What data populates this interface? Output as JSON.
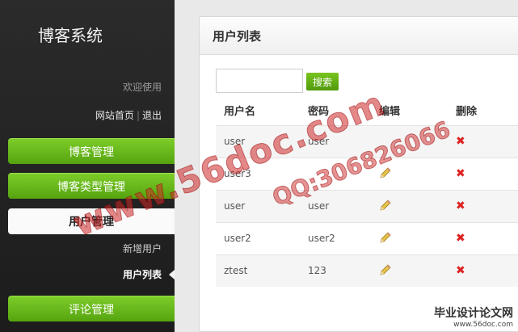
{
  "sidebar": {
    "brand": "博客系统",
    "welcome": "欢迎使用",
    "link_home": "网站首页",
    "link_sep": "|",
    "link_logout": "退出",
    "nav": {
      "blog_manage": "博客管理",
      "blog_type_manage": "博客类型管理",
      "user_manage": "用户管理",
      "sub_add_user": "新增用户",
      "sub_user_list": "用户列表",
      "comment_manage": "评论管理"
    }
  },
  "panel": {
    "title": "用户列表",
    "search_value": "",
    "search_placeholder": "",
    "search_button": "搜索"
  },
  "table": {
    "headers": [
      "用户名",
      "密码",
      "编辑",
      "删除"
    ],
    "rows": [
      {
        "username": "user",
        "password": "user",
        "editable": false
      },
      {
        "username": "user3",
        "password": "",
        "editable": true
      },
      {
        "username": "user",
        "password": "user",
        "editable": true
      },
      {
        "username": "user2",
        "password": "user2",
        "editable": true
      },
      {
        "username": "ztest",
        "password": "123",
        "editable": true
      }
    ],
    "delete_glyph": "✖"
  },
  "watermark": {
    "site": "www.56doc.com",
    "qq": "QQ:306826066"
  },
  "footer_logo": {
    "title": "毕业设计论文网",
    "url": "www.56doc.com"
  },
  "colors": {
    "sidebar_bg": "#222222",
    "nav_green": "#6cba1e",
    "delete_red": "#dd2222",
    "watermark_red": "#cd2828"
  }
}
